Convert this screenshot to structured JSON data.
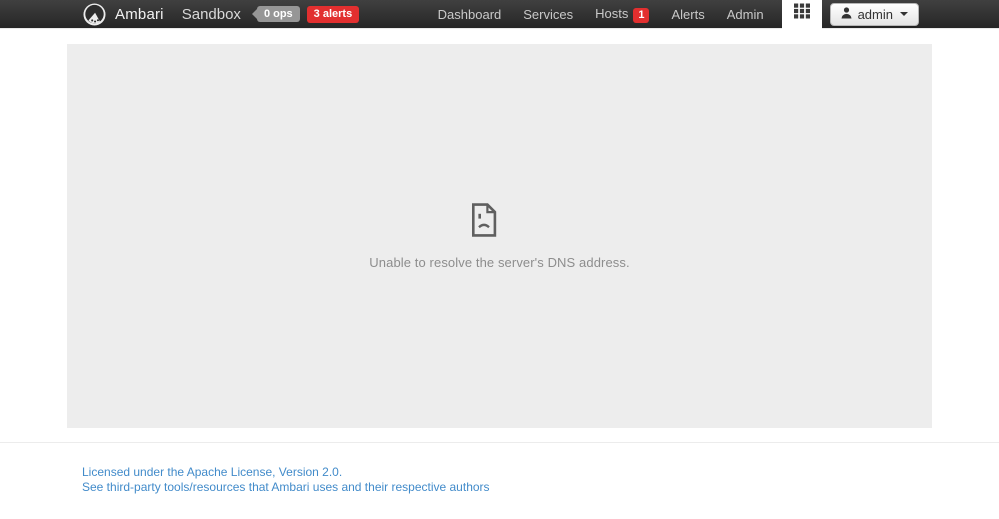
{
  "navbar": {
    "brand": "Ambari",
    "cluster_name": "Sandbox",
    "ops_badge": "0 ops",
    "alerts_badge": "3 alerts",
    "nav_items": [
      {
        "label": "Dashboard"
      },
      {
        "label": "Services"
      },
      {
        "label": "Hosts",
        "badge": "1"
      },
      {
        "label": "Alerts"
      },
      {
        "label": "Admin"
      }
    ],
    "user_menu": {
      "label": "admin"
    }
  },
  "main": {
    "error_message": "Unable to resolve the server's DNS address."
  },
  "footer": {
    "links": [
      "Licensed under the Apache License, Version 2.0.",
      "See third-party tools/resources that Ambari uses and their respective authors"
    ]
  },
  "colors": {
    "navbar_dark": "#333333",
    "alert_red": "#e22f2f",
    "ops_gray": "#969696",
    "link_blue": "#428bca",
    "content_bg": "#ededed",
    "error_text": "#8d8d8d"
  }
}
